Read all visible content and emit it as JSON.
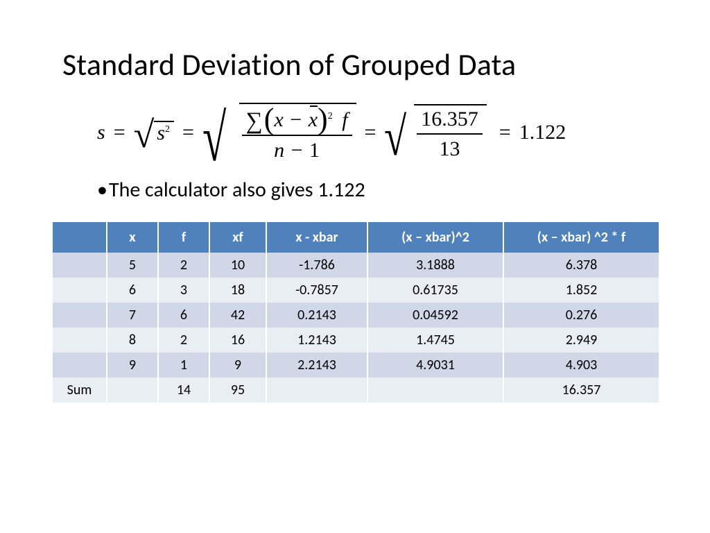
{
  "title": "Standard Deviation of Grouped Data",
  "formula": {
    "s": "s",
    "eq": "=",
    "s2": "s",
    "s2_exp": "2",
    "sum": "∑",
    "x": "x",
    "minus": "−",
    "xbar": "x",
    "sq_exp": "2",
    "f": "f",
    "n": "n",
    "one": "1",
    "num2": "16.357",
    "den2": "13",
    "result": "1.122"
  },
  "bullet": "The calculator also gives 1.122",
  "table": {
    "headers": [
      "",
      "x",
      "f",
      "xf",
      "x - xbar",
      "(x – xbar)^2",
      "(x – xbar) ^2 * f"
    ],
    "rows": [
      [
        "",
        "5",
        "2",
        "10",
        "-1.786",
        "3.1888",
        "6.378"
      ],
      [
        "",
        "6",
        "3",
        "18",
        "-0.7857",
        "0.61735",
        "1.852"
      ],
      [
        "",
        "7",
        "6",
        "42",
        "0.2143",
        "0.04592",
        "0.276"
      ],
      [
        "",
        "8",
        "2",
        "16",
        "1.2143",
        "1.4745",
        "2.949"
      ],
      [
        "",
        "9",
        "1",
        "9",
        "2.2143",
        "4.9031",
        "4.903"
      ],
      [
        "Sum",
        "",
        "14",
        "95",
        "",
        "",
        "16.357"
      ]
    ]
  }
}
